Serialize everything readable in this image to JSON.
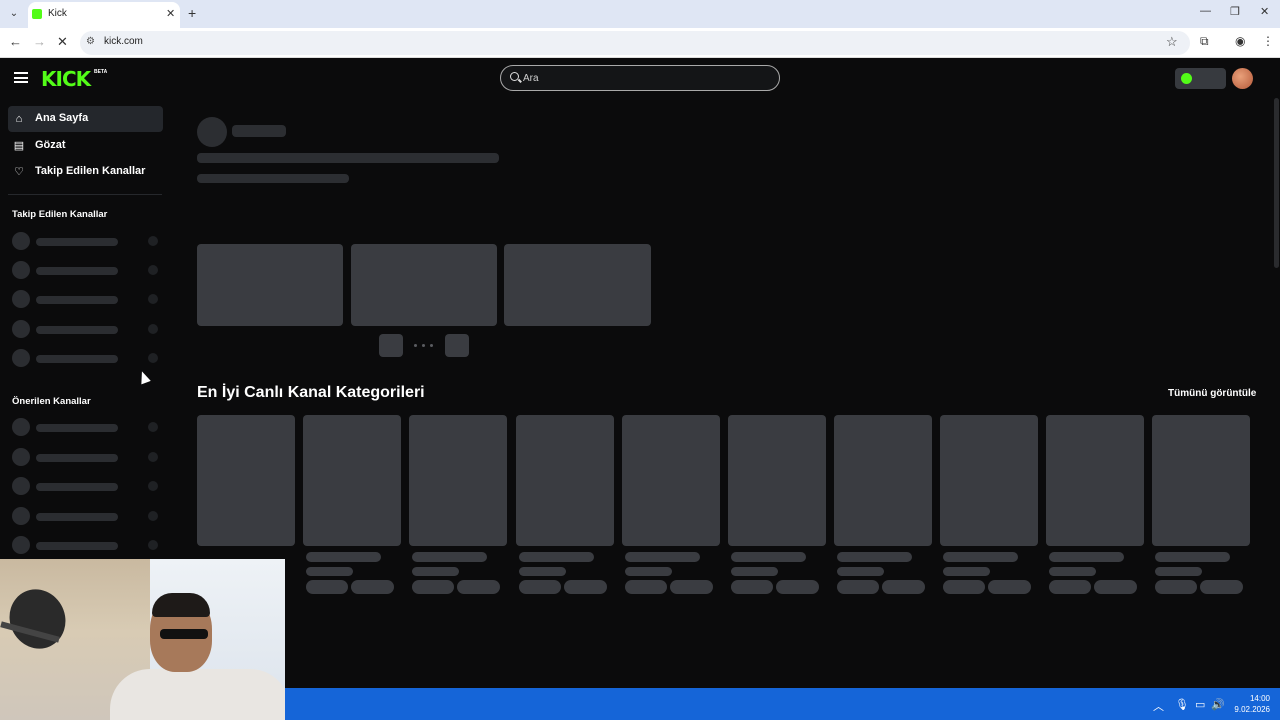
{
  "browser": {
    "tab_title": "Kick",
    "url": "kick.com",
    "new_tab_symbol": "+",
    "close_symbol": "✕"
  },
  "header": {
    "logo_text": "KICK",
    "logo_badge": "BETA",
    "search_placeholder": "Ara"
  },
  "sidebar": {
    "nav": [
      {
        "label": "Ana Sayfa",
        "icon": "home-icon",
        "active": true
      },
      {
        "label": "Gözat",
        "icon": "browse-icon",
        "active": false
      },
      {
        "label": "Takip Edilen Kanallar",
        "icon": "heart-icon",
        "active": false
      }
    ],
    "followed_heading": "Takip Edilen Kanallar",
    "recommended_heading": "Önerilen Kanallar"
  },
  "main": {
    "categories_title": "En İyi Canlı Kanal Kategorileri",
    "view_all_label": "Tümünü görüntüle"
  },
  "taskbar": {
    "time": "14:00",
    "date": "9.02.2026"
  },
  "colors": {
    "brand": "#53fc18",
    "background": "#0b0b0c",
    "skeleton": "#3a3c41",
    "taskbar": "#1565d8"
  }
}
